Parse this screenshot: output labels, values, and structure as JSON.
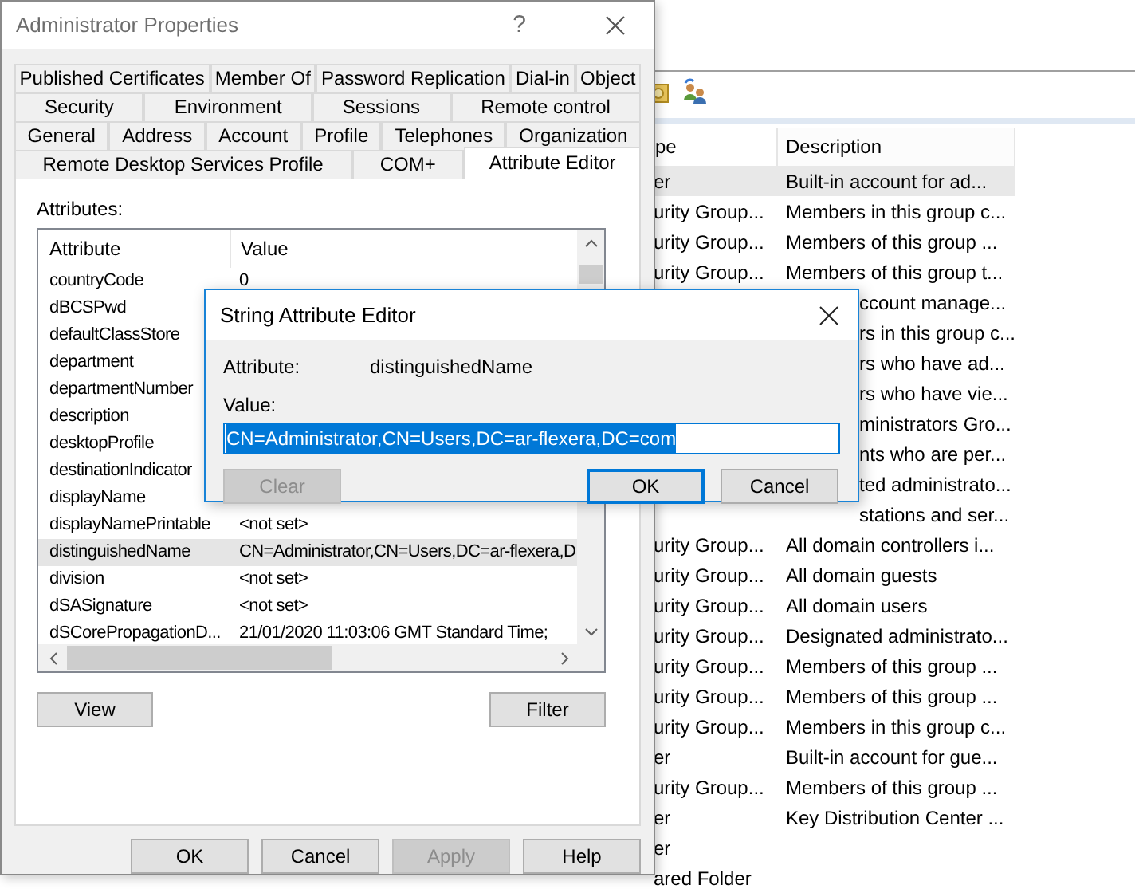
{
  "background_window": {
    "list": {
      "columns": [
        "pe",
        "Description"
      ],
      "rows": [
        {
          "kind": "full",
          "type": "er",
          "description": "Built-in account for ad...",
          "selected": true
        },
        {
          "kind": "full",
          "type": "urity Group...",
          "description": "Members in this group c...",
          "selected": false
        },
        {
          "kind": "full",
          "type": "urity Group...",
          "description": "Members of this group ...",
          "selected": false
        },
        {
          "kind": "full",
          "type": "urity Group...",
          "description": "Members of this group t...",
          "selected": false
        },
        {
          "kind": "partial",
          "description": "ccount manage...",
          "selected": false
        },
        {
          "kind": "partial",
          "description": "rs in this group c...",
          "selected": false
        },
        {
          "kind": "partial",
          "description": "rs who have ad...",
          "selected": false
        },
        {
          "kind": "partial",
          "description": "rs who have vie...",
          "selected": false
        },
        {
          "kind": "partial",
          "description": "ministrators Gro...",
          "selected": false
        },
        {
          "kind": "partial",
          "description": "nts who are per...",
          "selected": false
        },
        {
          "kind": "partial",
          "description": "ted administrato...",
          "selected": false
        },
        {
          "kind": "partial",
          "description": "stations and ser...",
          "selected": false
        },
        {
          "kind": "full",
          "type": "urity Group...",
          "description": "All domain controllers i...",
          "selected": false
        },
        {
          "kind": "full",
          "type": "urity Group...",
          "description": "All domain guests",
          "selected": false
        },
        {
          "kind": "full",
          "type": "urity Group...",
          "description": "All domain users",
          "selected": false
        },
        {
          "kind": "full",
          "type": "urity Group...",
          "description": "Designated administrato...",
          "selected": false
        },
        {
          "kind": "full",
          "type": "urity Group...",
          "description": "Members of this group ...",
          "selected": false
        },
        {
          "kind": "full",
          "type": "urity Group...",
          "description": "Members of this group ...",
          "selected": false
        },
        {
          "kind": "full",
          "type": "urity Group...",
          "description": "Members in this group c...",
          "selected": false
        },
        {
          "kind": "full",
          "type": "er",
          "description": "Built-in account for gue...",
          "selected": false
        },
        {
          "kind": "full",
          "type": "urity Group...",
          "description": "Members of this group ...",
          "selected": false
        },
        {
          "kind": "full",
          "type": "er",
          "description": "Key Distribution Center ...",
          "selected": false
        },
        {
          "kind": "full",
          "type": "er",
          "selected": false
        },
        {
          "kind": "full",
          "type": "ared Folder",
          "selected": false
        }
      ]
    }
  },
  "properties_dialog": {
    "title": "Administrator Properties",
    "help": "?",
    "tab_rows": [
      [
        {
          "label": "Published Certificates",
          "selected": false
        },
        {
          "label": "Member Of",
          "selected": false
        },
        {
          "label": "Password Replication",
          "selected": false
        },
        {
          "label": "Dial-in",
          "selected": false
        },
        {
          "label": "Object",
          "selected": false
        }
      ],
      [
        {
          "label": "Security",
          "selected": false
        },
        {
          "label": "Environment",
          "selected": false
        },
        {
          "label": "Sessions",
          "selected": false
        },
        {
          "label": "Remote control",
          "selected": false
        }
      ],
      [
        {
          "label": "General",
          "selected": false
        },
        {
          "label": "Address",
          "selected": false
        },
        {
          "label": "Account",
          "selected": false
        },
        {
          "label": "Profile",
          "selected": false
        },
        {
          "label": "Telephones",
          "selected": false
        },
        {
          "label": "Organization",
          "selected": false
        }
      ],
      [
        {
          "label": "Remote Desktop Services Profile",
          "selected": false
        },
        {
          "label": "COM+",
          "selected": false
        },
        {
          "label": "Attribute Editor",
          "selected": true
        }
      ]
    ],
    "attributes_label": "Attributes:",
    "attributes": {
      "columns": [
        "Attribute",
        "Value"
      ],
      "rows": [
        {
          "name": "countryCode",
          "value": "0",
          "selected": false
        },
        {
          "name": "dBCSPwd",
          "selected": false
        },
        {
          "name": "defaultClassStore",
          "selected": false
        },
        {
          "name": "department",
          "selected": false
        },
        {
          "name": "departmentNumber",
          "selected": false
        },
        {
          "name": "description",
          "selected": false
        },
        {
          "name": "desktopProfile",
          "selected": false
        },
        {
          "name": "destinationIndicator",
          "selected": false
        },
        {
          "name": "displayName",
          "selected": false
        },
        {
          "name": "displayNamePrintable",
          "value": "<not set>",
          "selected": false
        },
        {
          "name": "distinguishedName",
          "value": "CN=Administrator,CN=Users,DC=ar-flexera,D",
          "selected": true
        },
        {
          "name": "division",
          "value": "<not set>",
          "selected": false
        },
        {
          "name": "dSASignature",
          "value": "<not set>",
          "selected": false
        },
        {
          "name": "dSCorePropagationD...",
          "value": "21/01/2020 11:03:06 GMT Standard Time;",
          "selected": false
        }
      ]
    },
    "list_buttons": [
      "View",
      "Filter"
    ],
    "buttons": [
      {
        "label": "OK",
        "disabled": false
      },
      {
        "label": "Cancel",
        "disabled": false
      },
      {
        "label": "Apply",
        "disabled": true
      },
      {
        "label": "Help",
        "disabled": false
      }
    ]
  },
  "string_editor": {
    "title": "String Attribute Editor",
    "attribute_label": "Attribute:",
    "attribute": "distinguishedName",
    "value_label": "Value:",
    "value": "CN=Administrator,CN=Users,DC=ar-flexera,DC=com",
    "buttons": [
      {
        "label": "Clear",
        "disabled": true,
        "default": false
      },
      {
        "label": "OK",
        "disabled": false,
        "default": true
      },
      {
        "label": "Cancel",
        "disabled": false,
        "default": false
      }
    ]
  }
}
